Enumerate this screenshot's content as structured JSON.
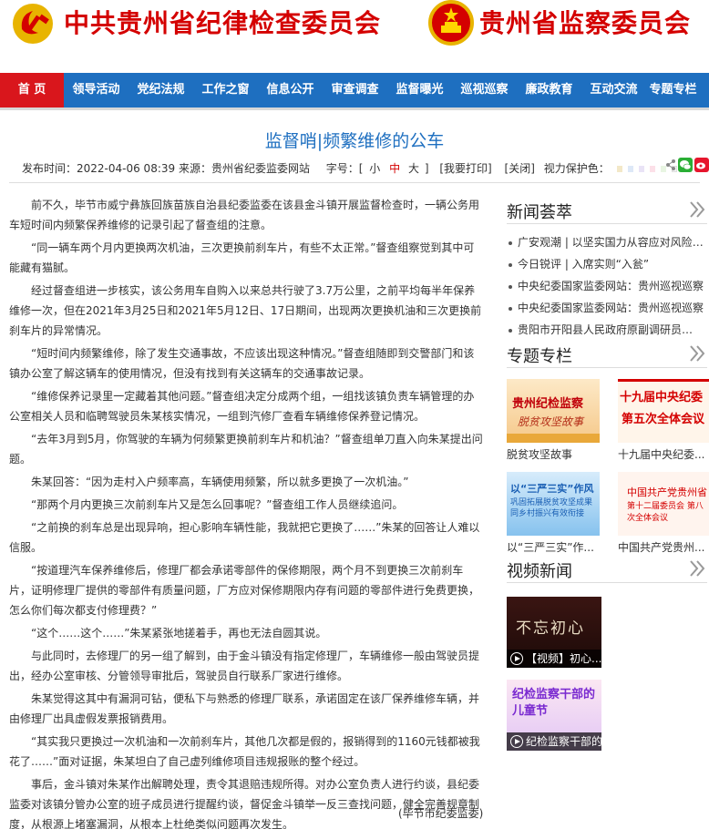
{
  "header": {
    "title_left": "中共贵州省纪律检查委员会",
    "title_right": "贵州省监察委员会",
    "left_emblem": "party-emblem-icon",
    "right_emblem": "national-emblem-icon"
  },
  "nav": [
    "首 页",
    "领导活动",
    "党纪法规",
    "工作之窗",
    "信息公开",
    "审查调查",
    "监督曝光",
    "巡视巡察",
    "廉政教育",
    "互动交流",
    "专题专栏"
  ],
  "article": {
    "title": "监督哨|频繁维修的公车",
    "publish_time": "发布时间：2022-04-06 08:39 来源：贵州省纪委监委网站",
    "font_size_label": "字号：[",
    "font_small": "小",
    "font_medium": "中",
    "font_large": "大",
    "font_close": "]",
    "print": "[我要打印]",
    "close": "[关闭]",
    "eye_protect": "视力保护色：",
    "paragraphs": [
      "前不久，毕节市威宁彝族回族苗族自治县纪委监委在该县金斗镇开展监督检查时，一辆公务用车短时间内频繁保养维修的记录引起了督查组的注意。",
      "“同一辆车两个月内更换两次机油，三次更换前刹车片，有些不太正常。”督查组察觉到其中可能藏有猫腻。",
      "经过督查组进一步核实，该公务用车自购入以来总共行驶了3.7万公里，之前平均每半年保养维修一次，但在2021年3月25日和2021年5月12日、17日期间，出现两次更换机油和三次更换前刹车片的异常情况。",
      "“短时间内频繁维修，除了发生交通事故，不应该出现这种情况。”督查组随即到交警部门和该镇办公室了解这辆车的使用情况，但没有找到有关这辆车的交通事故记录。",
      "“维修保养记录里一定藏着其他问题。”督查组决定分成两个组，一组找该镇负责车辆管理的办公室相关人员和临聘驾驶员朱某核实情况，一组到汽修厂查看车辆维修保养登记情况。",
      "“去年3月到5月，你驾驶的车辆为何频繁更换前刹车片和机油？”督查组单刀直入向朱某提出问题。",
      "朱某回答：“因为走村入户频率高，车辆使用频繁，所以就多更换了一次机油。”",
      "“那两个月内更换三次前刹车片又是怎么回事呢？”督查组工作人员继续追问。",
      "“之前换的刹车总是出现异响，担心影响车辆性能，我就把它更换了……”朱某的回答让人难以信服。",
      "“按道理汽车保养维修后，修理厂都会承诺零部件的保修期限，两个月不到更换三次前刹车片，证明修理厂提供的零部件有质量问题，厂方应对保修期限内存有问题的零部件进行免费更换，怎么你们每次都支付修理费？”",
      "“这个……这个……”朱某紧张地搓着手，再也无法自圆其说。",
      "与此同时，去修理厂的另一组了解到，由于金斗镇没有指定修理厂，车辆维修一般由驾驶员提出，经办公室审核、分管领导审批后，驾驶员自行联系厂家进行维修。",
      "朱某觉得这其中有漏洞可钻，便私下与熟悉的修理厂联系，承诺固定在该厂保养维修车辆，并由修理厂出具虚假发票报销费用。",
      "“其实我只更换过一次机油和一次前刹车片，其他几次都是假的，报销得到的1160元钱都被我花了……”面对证据，朱某坦白了自己虚列维修项目违规报账的整个经过。",
      "事后，金斗镇对朱某作出解聘处理，责令其退赔违规所得。对办公室负责人进行约谈，县纪委监委对该镇分管办公室的班子成员进行提醒约谈，督促金斗镇举一反三查找问题，健全完善规章制度，从根源上堵塞漏洞，从根本上杜绝类似问题再次发生。"
    ],
    "source": "(毕节市纪委监委)"
  },
  "sidebar": {
    "news_heading": "新闻荟萃",
    "news": [
      "广安观潮 | 以坚实国力从容应对风险挑战",
      "今日锐评 | 入席实则“入瓮”",
      "中央纪委国家监委网站：贵州巡视巡察",
      "中央纪委国家监委网站：贵州巡视巡察",
      "贵阳市开阳县人民政府原副调研员张某某"
    ],
    "special_heading": "专题专栏",
    "specials": [
      {
        "caption": "脱贫攻坚故事",
        "img_title": "贵州纪检监察",
        "img_sub": "脱贫攻坚故事"
      },
      {
        "caption": "十九届中央纪委...",
        "img_title": "十九届中央纪委",
        "img_sub": "第五次全体会议"
      },
      {
        "caption": "以“三严三实”作...",
        "img_title": "以“三严三实”作风",
        "img_sub": "巩固拓展脱贫攻坚成果 同乡村振兴有效衔接"
      },
      {
        "caption": "中国共产党贵州...",
        "img_title": "中国共产党贵州省",
        "img_sub": "第十二届委员会 第八次全体会议"
      }
    ],
    "video_heading": "视频新闻",
    "videos": [
      {
        "caption": "【视频】初心...",
        "img_text": "不忘初心"
      },
      {
        "caption": "纪检监察干部的",
        "img_text": "纪检监察干部的 儿童节"
      }
    ]
  },
  "colors": {
    "brand_red": "#d40000",
    "nav_blue": "#1e6fc0",
    "nav_active": "#d9161c",
    "eye_swatches": [
      "#f3e8c8",
      "#dde8f7",
      "#e9e3f6",
      "#fce0e8",
      "#e8f5e2",
      "#f5f5f5"
    ]
  }
}
